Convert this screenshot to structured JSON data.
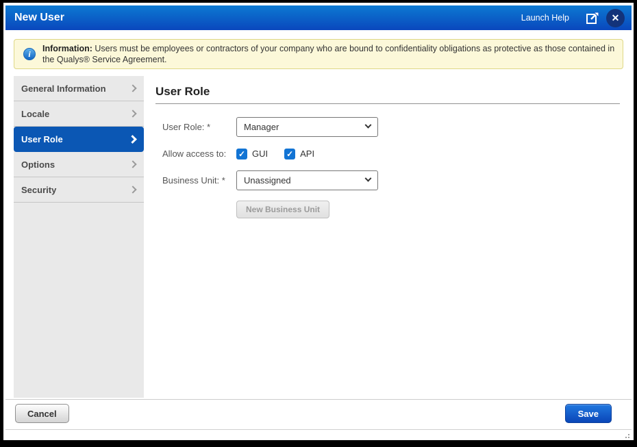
{
  "titlebar": {
    "title": "New User",
    "help_link": "Launch Help"
  },
  "banner": {
    "label": "Information:",
    "text": " Users must be employees or contractors of your company who are bound to confidentiality obligations as protective as those contained in the Qualys® Service Agreement."
  },
  "sidebar": {
    "items": [
      {
        "label": "General Information",
        "selected": false
      },
      {
        "label": "Locale",
        "selected": false
      },
      {
        "label": "User Role",
        "selected": true
      },
      {
        "label": "Options",
        "selected": false
      },
      {
        "label": "Security",
        "selected": false
      }
    ]
  },
  "content": {
    "heading": "User Role",
    "user_role": {
      "label": "User Role: *",
      "value": "Manager"
    },
    "access": {
      "label": "Allow access to:",
      "options": [
        {
          "label": "GUI",
          "checked": true
        },
        {
          "label": "API",
          "checked": true
        }
      ]
    },
    "business_unit": {
      "label": "Business Unit: *",
      "value": "Unassigned"
    },
    "new_business_unit_label": "New Business Unit"
  },
  "footer": {
    "cancel_label": "Cancel",
    "save_label": "Save"
  },
  "glyphs": {
    "close": "✕",
    "check": "✓",
    "info": "i"
  },
  "colors": {
    "titlebar_top": "#0c7ad2",
    "titlebar_bottom": "#0a47bd",
    "selected_item_blue": "#0b57b4",
    "checkbox_blue": "#1274d4",
    "save_button_top": "#2178e0",
    "save_button_bottom": "#0a46b8",
    "banner_bg": "#fcf8d9",
    "banner_border": "#ded786",
    "sidebar_bg": "#e9e9e9"
  }
}
